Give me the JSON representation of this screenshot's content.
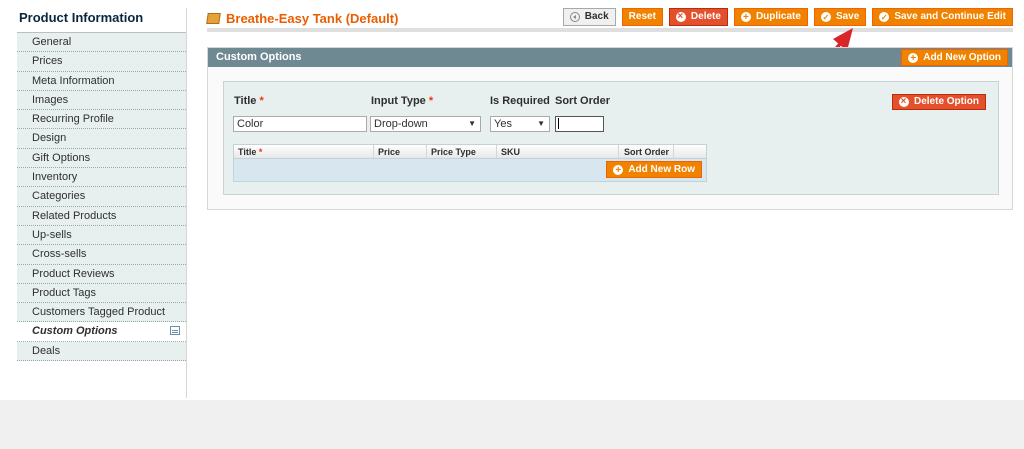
{
  "sidebar": {
    "title": "Product Information",
    "items": [
      {
        "label": "General"
      },
      {
        "label": "Prices"
      },
      {
        "label": "Meta Information"
      },
      {
        "label": "Images"
      },
      {
        "label": "Recurring Profile"
      },
      {
        "label": "Design"
      },
      {
        "label": "Gift Options"
      },
      {
        "label": "Inventory"
      },
      {
        "label": "Categories"
      },
      {
        "label": "Related Products"
      },
      {
        "label": "Up-sells"
      },
      {
        "label": "Cross-sells"
      },
      {
        "label": "Product Reviews"
      },
      {
        "label": "Product Tags"
      },
      {
        "label": "Customers Tagged Product"
      },
      {
        "label": "Custom Options",
        "active": true
      },
      {
        "label": "Deals"
      }
    ]
  },
  "header": {
    "title": "Breathe-Easy Tank (Default)",
    "buttons": {
      "back": "Back",
      "reset": "Reset",
      "delete": "Delete",
      "duplicate": "Duplicate",
      "save": "Save",
      "save_continue": "Save and Continue Edit"
    }
  },
  "panel": {
    "title": "Custom Options",
    "add_option": "Add New Option",
    "option": {
      "title_label": "Title",
      "input_type_label": "Input Type",
      "is_required_label": "Is Required",
      "sort_order_label": "Sort Order",
      "required_mark": "*",
      "title_value": "Color",
      "input_type_value": "Drop-down",
      "is_required_value": "Yes",
      "sort_order_value": "",
      "delete_option": "Delete Option",
      "grid": {
        "columns": [
          "Title",
          "Price",
          "Price Type",
          "SKU",
          "Sort Order"
        ],
        "add_row": "Add New Row"
      }
    }
  },
  "colors": {
    "accent": "#f18200",
    "danger": "#e4502c",
    "title": "#eb5e00",
    "panel_header": "#6f8992",
    "arrow": "#d9242a"
  }
}
